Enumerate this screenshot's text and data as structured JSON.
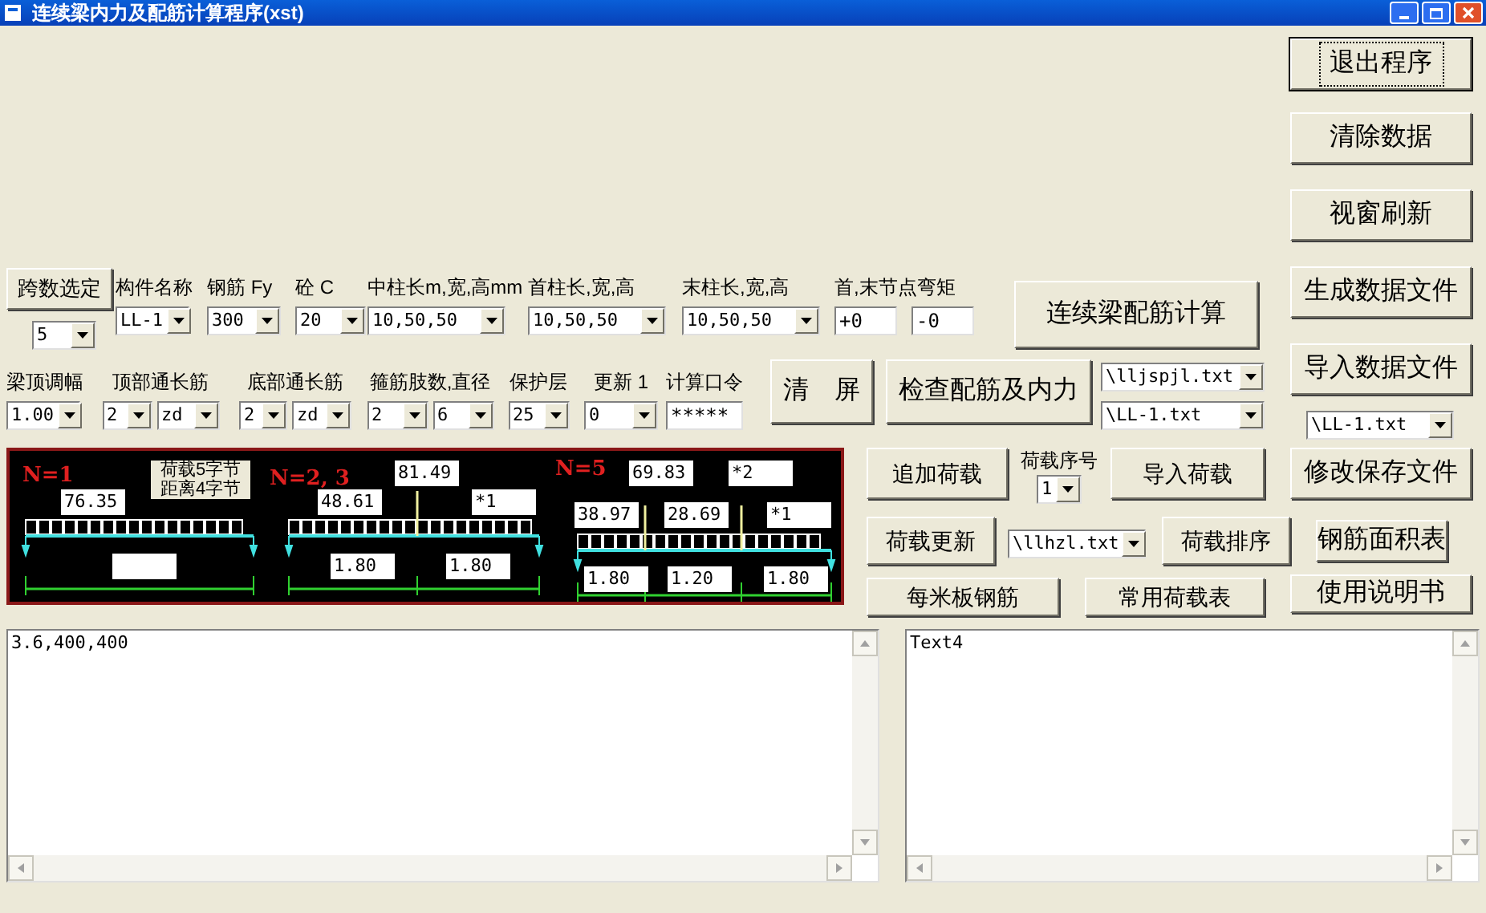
{
  "window": {
    "title": "连续梁内力及配筋计算程序(xst)"
  },
  "span_count": {
    "button": "跨数选定",
    "value": "5"
  },
  "row_1": [
    {
      "label": "构件名称",
      "values": [
        "LL-1"
      ]
    },
    {
      "label": "钢筋 Fy",
      "values": [
        "300"
      ]
    },
    {
      "label": "砼 C",
      "values": [
        "20"
      ]
    },
    {
      "label": "中柱长m,宽,高mm",
      "values": [
        "10,50,50"
      ]
    },
    {
      "label": "首柱长,宽,高",
      "values": [
        "10,50,50"
      ]
    },
    {
      "label": "末柱长,宽,高",
      "values": [
        "10,50,50"
      ]
    }
  ],
  "node_moments": {
    "label": "首,末节点弯矩",
    "fields": [
      "+0",
      "-0"
    ]
  },
  "calc_button": "连续梁配筋计算",
  "row_2": [
    {
      "label": "梁顶调幅",
      "values": [
        "1.00"
      ]
    },
    {
      "label": "顶部通长筋",
      "values": [
        "2",
        "zd"
      ]
    },
    {
      "label": "底部通长筋",
      "values": [
        "2",
        "zd"
      ]
    },
    {
      "label": "箍筋肢数,直径",
      "values": [
        "2",
        "6"
      ]
    },
    {
      "label": "保护层",
      "values": [
        "25"
      ]
    },
    {
      "label": "更新 1",
      "values": [
        "0"
      ]
    }
  ],
  "password": {
    "label": "计算口令",
    "value": "*****"
  },
  "clear_button": "清　屏",
  "check_button": "检查配筋及内力",
  "file_dropdowns": [
    "\\lljspjl.txt",
    "\\LL-1.txt"
  ],
  "diagram": {
    "note": [
      "荷载5字节",
      "距离4字节"
    ],
    "cases": [
      {
        "label": "N=1",
        "values": [
          "76.35"
        ]
      },
      {
        "label": "N=2, 3",
        "values": [
          "81.49",
          "48.61",
          "*1",
          "1.80",
          "1.80"
        ]
      },
      {
        "label": "N=5",
        "values": [
          "69.83",
          "*2",
          "38.97",
          "28.69",
          "*1",
          "1.80",
          "1.20",
          "1.80"
        ]
      }
    ]
  },
  "load_controls": {
    "add": "追加荷载",
    "index_label": "荷载序号",
    "index": "1",
    "import": "导入荷载",
    "update": "荷载更新",
    "file": "\\llhzl.txt",
    "sort": "荷载排序",
    "slab": "每米板钢筋",
    "common": "常用荷载表"
  },
  "side_panel": [
    {
      "kind": "button",
      "label": "退出程序",
      "focused": true
    },
    {
      "kind": "button",
      "label": "清除数据",
      "focused": false
    },
    {
      "kind": "button",
      "label": "视窗刷新",
      "focused": false
    },
    {
      "kind": "button",
      "label": "生成数据文件",
      "focused": false
    },
    {
      "kind": "button",
      "label": "导入数据文件",
      "focused": false
    },
    {
      "kind": "dropdown",
      "value": "\\LL-1.txt"
    },
    {
      "kind": "button",
      "label": "修改保存文件",
      "focused": false
    },
    {
      "kind": "button",
      "label": "钢筋面积表",
      "focused": false
    },
    {
      "kind": "button",
      "label": "使用说明书",
      "focused": false
    }
  ],
  "output_boxes": [
    "3.6,400,400",
    "Text4"
  ]
}
